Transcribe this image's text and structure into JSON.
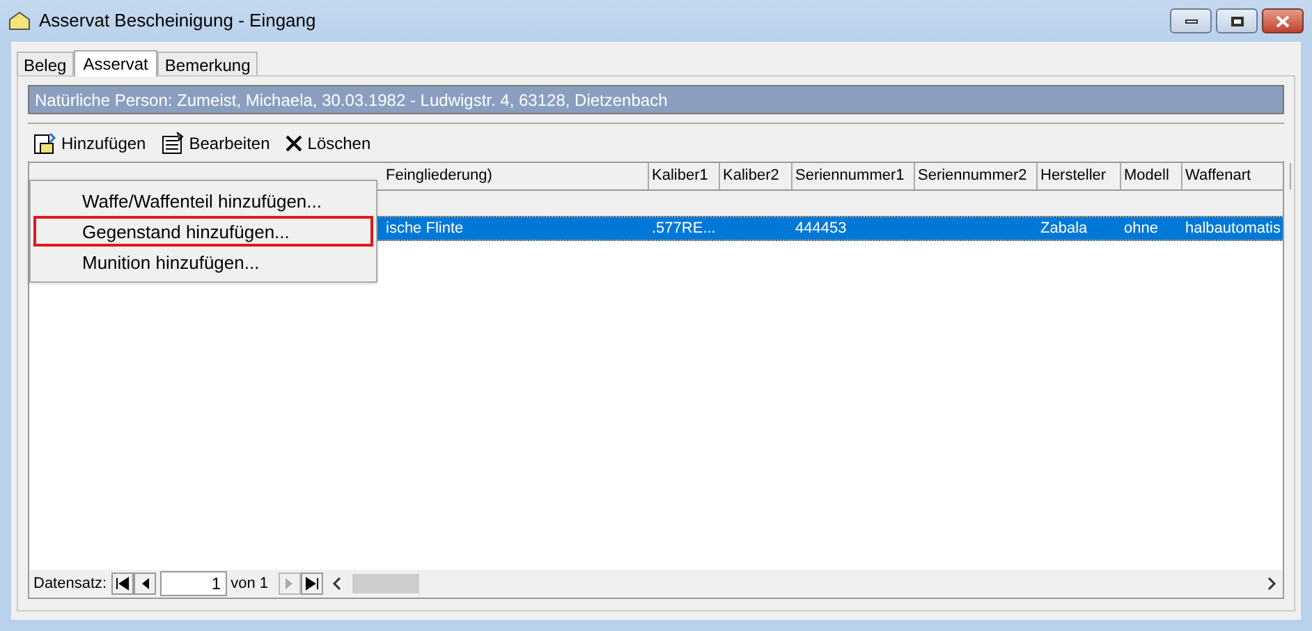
{
  "window": {
    "title": "Asservat Bescheinigung - Eingang"
  },
  "tabs": [
    {
      "label": "Beleg",
      "selected": false
    },
    {
      "label": "Asservat",
      "selected": true
    },
    {
      "label": "Bemerkung",
      "selected": false
    }
  ],
  "info_bar": "Natürliche Person: Zumeist, Michaela, 30.03.1982 - Ludwigstr. 4, 63128, Dietzenbach",
  "toolbar": [
    {
      "label": "Hinzufügen",
      "kind": "add"
    },
    {
      "label": "Bearbeiten",
      "kind": "edit"
    },
    {
      "label": "Löschen",
      "kind": "delete"
    }
  ],
  "menu": [
    {
      "label": "Waffe/Waffenteil hinzufügen...",
      "marked": false
    },
    {
      "label": "Gegenstand hinzufügen...",
      "marked": true
    },
    {
      "label": "Munition hinzufügen...",
      "marked": false
    }
  ],
  "table": {
    "columns": [
      "Feingliederung)",
      "Kaliber1",
      "Kaliber2",
      "Seriennummer1",
      "Seriennummer2",
      "Hersteller",
      "Modell",
      "Waffenart"
    ],
    "rows": [
      {
        "selected": true,
        "cells": [
          "ische Flinte",
          ".577RE...",
          "",
          "444453",
          "",
          "Zabala",
          "ohne",
          "halbautomatis"
        ]
      }
    ]
  },
  "footer": {
    "label": "Datensatz:",
    "record": "1",
    "of": "von 1"
  }
}
